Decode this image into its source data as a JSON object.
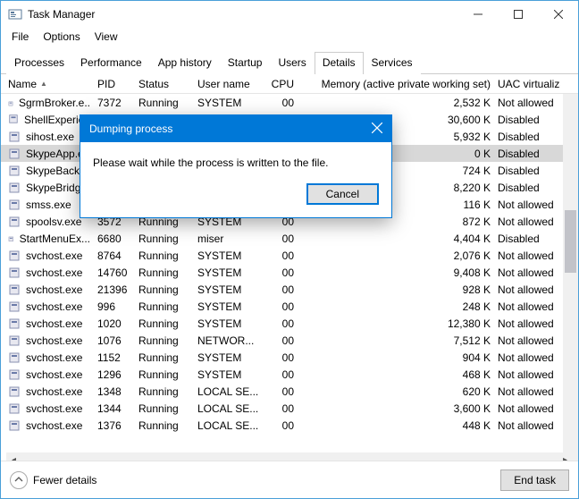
{
  "window": {
    "title": "Task Manager"
  },
  "menu": {
    "file": "File",
    "options": "Options",
    "view": "View"
  },
  "tabs": {
    "processes": "Processes",
    "performance": "Performance",
    "apphistory": "App history",
    "startup": "Startup",
    "users": "Users",
    "details": "Details",
    "services": "Services"
  },
  "columns": {
    "name": "Name",
    "pid": "PID",
    "status": "Status",
    "user": "User name",
    "cpu": "CPU",
    "memory": "Memory (active private working set)",
    "uac": "UAC virtualizat"
  },
  "rows": [
    {
      "name": "SgrmBroker.e..",
      "pid": "7372",
      "status": "Running",
      "user": "SYSTEM",
      "cpu": "00",
      "mem": "2,532 K",
      "uac": "Not allowed",
      "selected": false
    },
    {
      "name": "ShellExperien",
      "pid": "",
      "status": "",
      "user": "",
      "cpu": "",
      "mem": "30,600 K",
      "uac": "Disabled",
      "selected": false
    },
    {
      "name": "sihost.exe",
      "pid": "",
      "status": "",
      "user": "",
      "cpu": "",
      "mem": "5,932 K",
      "uac": "Disabled",
      "selected": false
    },
    {
      "name": "SkypeApp.ex",
      "pid": "",
      "status": "",
      "user": "",
      "cpu": "",
      "mem": "0 K",
      "uac": "Disabled",
      "selected": true
    },
    {
      "name": "SkypeBackgr",
      "pid": "",
      "status": "",
      "user": "",
      "cpu": "",
      "mem": "724 K",
      "uac": "Disabled",
      "selected": false
    },
    {
      "name": "SkypeBridge.",
      "pid": "",
      "status": "",
      "user": "",
      "cpu": "",
      "mem": "8,220 K",
      "uac": "Disabled",
      "selected": false
    },
    {
      "name": "smss.exe",
      "pid": "",
      "status": "",
      "user": "",
      "cpu": "",
      "mem": "116 K",
      "uac": "Not allowed",
      "selected": false
    },
    {
      "name": "spoolsv.exe",
      "pid": "3572",
      "status": "Running",
      "user": "SYSTEM",
      "cpu": "00",
      "mem": "872 K",
      "uac": "Not allowed",
      "selected": false
    },
    {
      "name": "StartMenuEx...",
      "pid": "6680",
      "status": "Running",
      "user": "miser",
      "cpu": "00",
      "mem": "4,404 K",
      "uac": "Disabled",
      "selected": false
    },
    {
      "name": "svchost.exe",
      "pid": "8764",
      "status": "Running",
      "user": "SYSTEM",
      "cpu": "00",
      "mem": "2,076 K",
      "uac": "Not allowed",
      "selected": false
    },
    {
      "name": "svchost.exe",
      "pid": "14760",
      "status": "Running",
      "user": "SYSTEM",
      "cpu": "00",
      "mem": "9,408 K",
      "uac": "Not allowed",
      "selected": false
    },
    {
      "name": "svchost.exe",
      "pid": "21396",
      "status": "Running",
      "user": "SYSTEM",
      "cpu": "00",
      "mem": "928 K",
      "uac": "Not allowed",
      "selected": false
    },
    {
      "name": "svchost.exe",
      "pid": "996",
      "status": "Running",
      "user": "SYSTEM",
      "cpu": "00",
      "mem": "248 K",
      "uac": "Not allowed",
      "selected": false
    },
    {
      "name": "svchost.exe",
      "pid": "1020",
      "status": "Running",
      "user": "SYSTEM",
      "cpu": "00",
      "mem": "12,380 K",
      "uac": "Not allowed",
      "selected": false
    },
    {
      "name": "svchost.exe",
      "pid": "1076",
      "status": "Running",
      "user": "NETWOR...",
      "cpu": "00",
      "mem": "7,512 K",
      "uac": "Not allowed",
      "selected": false
    },
    {
      "name": "svchost.exe",
      "pid": "1152",
      "status": "Running",
      "user": "SYSTEM",
      "cpu": "00",
      "mem": "904 K",
      "uac": "Not allowed",
      "selected": false
    },
    {
      "name": "svchost.exe",
      "pid": "1296",
      "status": "Running",
      "user": "SYSTEM",
      "cpu": "00",
      "mem": "468 K",
      "uac": "Not allowed",
      "selected": false
    },
    {
      "name": "svchost.exe",
      "pid": "1348",
      "status": "Running",
      "user": "LOCAL SE...",
      "cpu": "00",
      "mem": "620 K",
      "uac": "Not allowed",
      "selected": false
    },
    {
      "name": "svchost.exe",
      "pid": "1344",
      "status": "Running",
      "user": "LOCAL SE...",
      "cpu": "00",
      "mem": "3,600 K",
      "uac": "Not allowed",
      "selected": false
    },
    {
      "name": "svchost.exe",
      "pid": "1376",
      "status": "Running",
      "user": "LOCAL SE...",
      "cpu": "00",
      "mem": "448 K",
      "uac": "Not allowed",
      "selected": false
    }
  ],
  "dialog": {
    "title": "Dumping process",
    "message": "Please wait while the process is written to the file.",
    "cancel": "Cancel"
  },
  "footer": {
    "fewer": "Fewer details",
    "endtask": "End task"
  }
}
